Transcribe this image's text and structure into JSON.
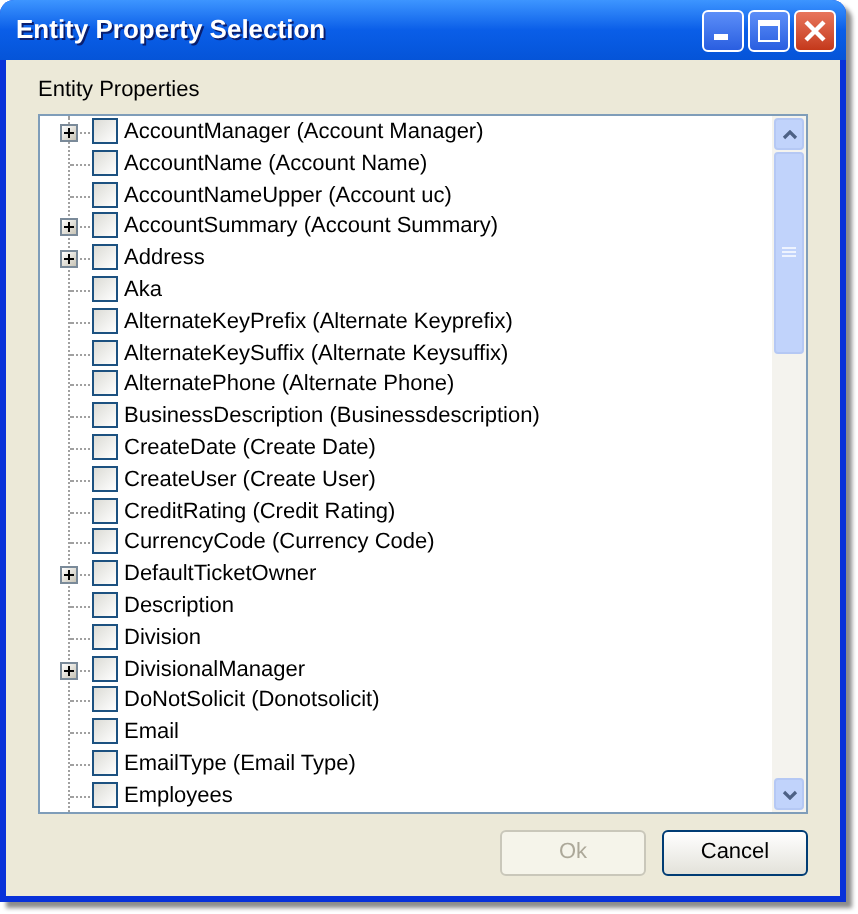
{
  "window": {
    "title": "Entity Property Selection"
  },
  "group_label": "Entity Properties",
  "tree": {
    "items": [
      {
        "label": "AccountManager (Account Manager)",
        "kind": "group",
        "checked": false
      },
      {
        "label": "AccountName (Account Name)",
        "kind": "leaf",
        "checked": false
      },
      {
        "label": "AccountNameUpper (Account uc)",
        "kind": "leaf",
        "checked": false
      },
      {
        "label": "AccountSummary (Account Summary)",
        "kind": "group",
        "checked": false
      },
      {
        "label": "Address",
        "kind": "group",
        "checked": false
      },
      {
        "label": "Aka",
        "kind": "leaf",
        "checked": false
      },
      {
        "label": "AlternateKeyPrefix (Alternate Keyprefix)",
        "kind": "leaf",
        "checked": false
      },
      {
        "label": "AlternateKeySuffix (Alternate Keysuffix)",
        "kind": "leaf",
        "checked": false
      },
      {
        "label": "AlternatePhone (Alternate Phone)",
        "kind": "leaf",
        "checked": false
      },
      {
        "label": "BusinessDescription (Businessdescription)",
        "kind": "leaf",
        "checked": false
      },
      {
        "label": "CreateDate (Create Date)",
        "kind": "leaf",
        "checked": false
      },
      {
        "label": "CreateUser (Create User)",
        "kind": "leaf",
        "checked": false
      },
      {
        "label": "CreditRating (Credit Rating)",
        "kind": "leaf",
        "checked": false
      },
      {
        "label": "CurrencyCode (Currency Code)",
        "kind": "leaf",
        "checked": false
      },
      {
        "label": "DefaultTicketOwner",
        "kind": "group",
        "checked": false
      },
      {
        "label": "Description",
        "kind": "leaf",
        "checked": false
      },
      {
        "label": "Division",
        "kind": "leaf",
        "checked": false
      },
      {
        "label": "DivisionalManager",
        "kind": "group",
        "checked": false
      },
      {
        "label": "DoNotSolicit (Donotsolicit)",
        "kind": "leaf",
        "checked": false
      },
      {
        "label": "Email",
        "kind": "leaf",
        "checked": false
      },
      {
        "label": "EmailType (Email Type)",
        "kind": "leaf",
        "checked": false
      },
      {
        "label": "Employees",
        "kind": "leaf",
        "checked": false
      }
    ]
  },
  "buttons": [
    {
      "label": "Ok",
      "disabled": true
    },
    {
      "label": "Cancel",
      "disabled": false
    }
  ]
}
